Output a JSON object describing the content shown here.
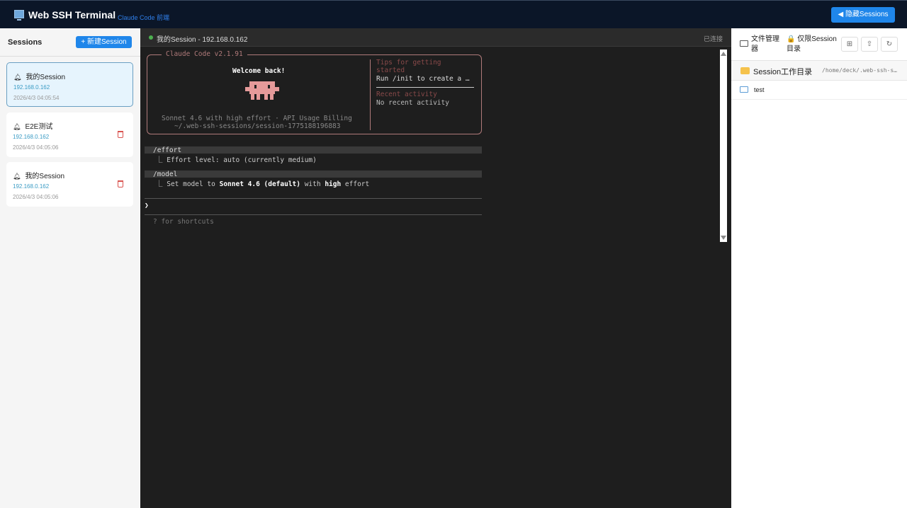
{
  "header": {
    "title": "Web SSH Terminal",
    "subtitle": "Claude Code 前端",
    "hide_sessions": "◀ 隐藏Sessions"
  },
  "sidebar": {
    "title": "Sessions",
    "new_button": "+  新建Session",
    "sessions": [
      {
        "name": "我的Session",
        "ip": "192.168.0.162",
        "time": "2026/4/3 04:05:54",
        "selected": true
      },
      {
        "name": "E2E测试",
        "ip": "192.168.0.162",
        "time": "2026/4/3 04:05:06"
      },
      {
        "name": "我的Session",
        "ip": "192.168.0.162",
        "time": "2026/4/3 04:05:06"
      }
    ]
  },
  "terminal": {
    "session_title": "我的Session - 192.168.0.162",
    "status": "已连接",
    "box_label": "Claude Code v2.1.91",
    "welcome": "Welcome back!",
    "model_line": "Sonnet 4.6 with high effort · API Usage Billing",
    "cwd": "~/.web-ssh-sessions/session-1775188196883",
    "tips_title1": "Tips for getting",
    "tips_title2": "started",
    "tips_body": "Run /init to create a …",
    "recent_title": "Recent activity",
    "recent_body": "No recent activity",
    "cmd1": "/effort",
    "out1": "Effort level: auto (currently medium)",
    "cmd2": "/model",
    "out2_a": "Set model to ",
    "out2_b": "Sonnet 4.6 (default)",
    "out2_c": " with ",
    "out2_d": "high",
    "out2_e": " effort",
    "prompt": "❯",
    "hint": "? for shortcuts"
  },
  "files": {
    "title": "文件管理器",
    "restrict": "🔒 仅限Session目录",
    "dir_label": "Session工作目录",
    "dir_path": "/home/deck/.web-ssh-s…",
    "items": [
      {
        "name": "test",
        "type": "folder"
      }
    ]
  }
}
